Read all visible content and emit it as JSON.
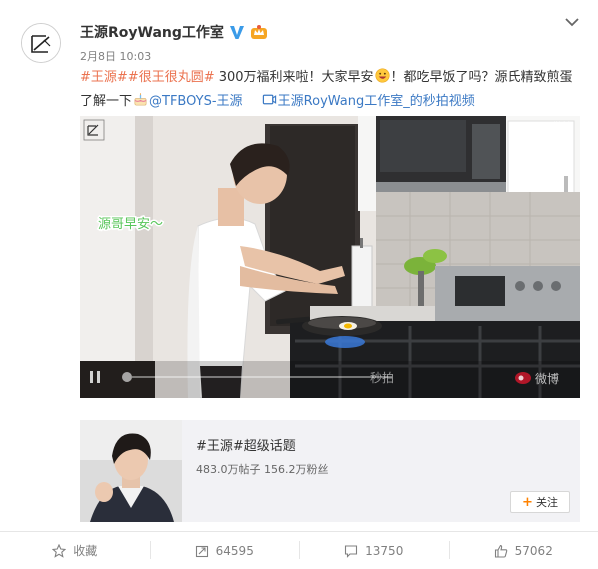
{
  "author": {
    "name": "王源RoyWang工作室"
  },
  "meta": {
    "date": "2月8日 10:03"
  },
  "post": {
    "tag1": "#王源#",
    "tag2": "#很王很丸圆#",
    "text1": " 300万福利来啦！大家早安",
    "text2": "！都吃早饭了吗？源氏精致煎蛋了解一下",
    "mention": "@TFBOYS-王源",
    "video_link": "王源RoyWang工作室_的秒拍视频"
  },
  "video": {
    "caption": "源哥早安～",
    "watermark": "@微博",
    "bottom_text": "秒拍",
    "logo": "微博"
  },
  "topic": {
    "title": "#王源#超级话题",
    "stats": "483.0万帖子 156.2万粉丝",
    "follow_label": "关注"
  },
  "actions": {
    "favorite": "收藏",
    "repost": "64595",
    "comment": "13750",
    "like": "57062"
  },
  "colors": {
    "link": "#eb7350",
    "blue_link": "#3b79c4",
    "accent": "#ff8200"
  },
  "icons": [
    "logo-icon",
    "verified-icon",
    "crown-icon",
    "chevron-down-icon",
    "grin-emoji-icon",
    "cake-emoji-icon",
    "video-link-icon",
    "star-icon",
    "repost-icon",
    "comment-icon",
    "like-icon"
  ]
}
